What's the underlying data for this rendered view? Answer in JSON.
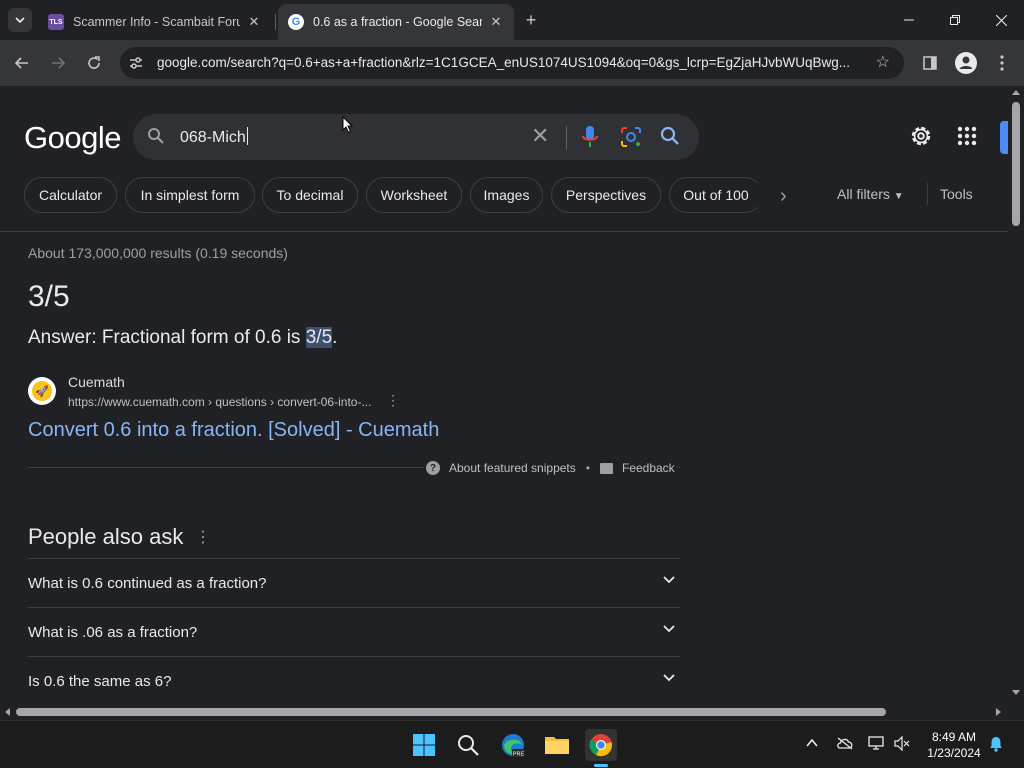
{
  "tabs": [
    {
      "title": "Scammer Info - Scambait Forum",
      "favicon": "TLS"
    },
    {
      "title": "0.6 as a fraction - Google Search",
      "favicon": "G"
    }
  ],
  "address_bar": {
    "url": "google.com/search?q=0.6+as+a+fraction&rlz=1C1GCEA_enUS1074US1094&oq=0&gs_lcrp=EgZjaHJvbWUqBwg..."
  },
  "search": {
    "logo": "Google",
    "query": "068-Mich"
  },
  "chips": [
    "Calculator",
    "In simplest form",
    "To decimal",
    "Worksheet",
    "Images",
    "Perspectives",
    "Out of 100"
  ],
  "filters": {
    "all_filters": "All filters",
    "tools": "Tools"
  },
  "stats": "About 173,000,000 results (0.19 seconds)",
  "featured": {
    "big_answer": "3/5",
    "answer_prefix": "Answer: Fractional form of 0.6 is ",
    "answer_highlight": "3/5",
    "answer_suffix": ".",
    "source_name": "Cuemath",
    "source_url": "https://www.cuemath.com › questions › convert-06-into-...",
    "link_text": "Convert 0.6 into a fraction. [Solved] - Cuemath",
    "about_snippets": "About featured snippets",
    "separator": "•",
    "feedback": "Feedback"
  },
  "people_also_ask": {
    "title": "People also ask",
    "questions": [
      "What is 0.6 continued as a fraction?",
      "What is .06 as a fraction?",
      "Is 0.6 the same as 6?"
    ]
  },
  "taskbar": {
    "time": "8:49 AM",
    "date": "1/23/2024"
  },
  "colors": {
    "background": "#202124",
    "link": "#8ab4f8",
    "accent": "#4c8bf5"
  }
}
